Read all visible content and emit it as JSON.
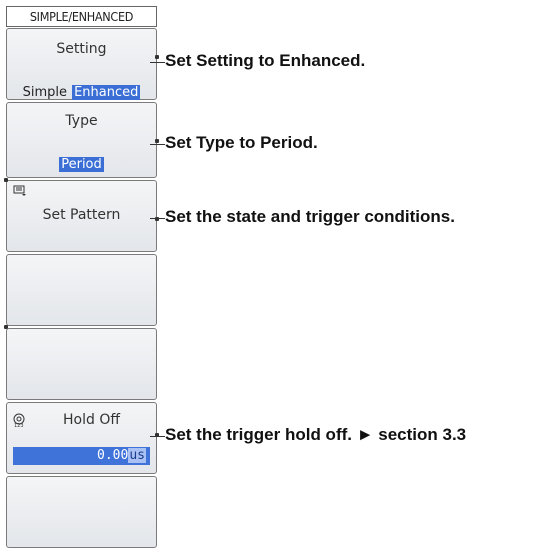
{
  "menu": {
    "header": "SIMPLE/ENHANCED",
    "setting": {
      "title": "Setting",
      "options": [
        "Simple",
        "Enhanced"
      ],
      "selected": "Enhanced"
    },
    "type": {
      "title": "Type",
      "value": "Period"
    },
    "set_pattern": {
      "title": "Set Pattern"
    },
    "hold_off": {
      "title": "Hold Off",
      "value": "0.00",
      "unit": "us"
    }
  },
  "callouts": {
    "setting": "Set Setting to Enhanced.",
    "type": "Set Type to Period.",
    "set_pattern": "Set the state and trigger conditions.",
    "hold_off": "Set the trigger hold off. ► section 3.3"
  },
  "colors": {
    "selection": "#3b6fd6",
    "panel": "#e3e6ea",
    "border": "#7a7a7a"
  },
  "icons": [
    "keyboard-icon",
    "knob-icon"
  ]
}
